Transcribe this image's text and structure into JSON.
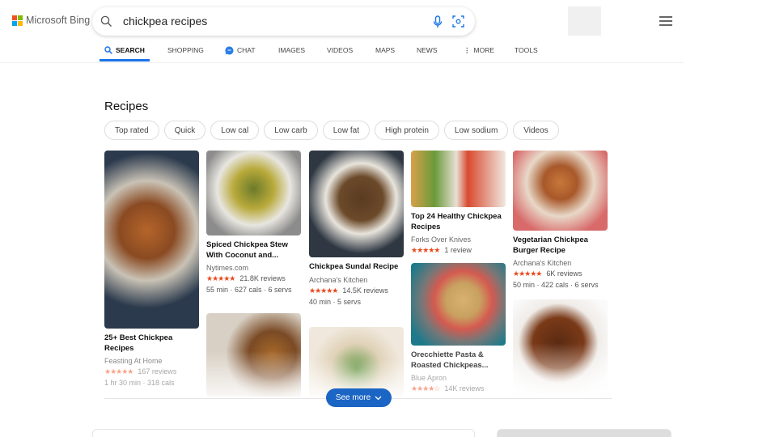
{
  "header": {
    "logo": "Microsoft Bing",
    "query": "chickpea recipes"
  },
  "nav": [
    {
      "label": "SEARCH",
      "icon": "search-icon",
      "active": true
    },
    {
      "label": "SHOPPING"
    },
    {
      "label": "CHAT",
      "icon": "chat-icon"
    },
    {
      "label": "IMAGES"
    },
    {
      "label": "VIDEOS"
    },
    {
      "label": "MAPS"
    },
    {
      "label": "NEWS"
    },
    {
      "label": "MORE",
      "icon": "more-vertical-icon"
    },
    {
      "label": "TOOLS"
    }
  ],
  "recipes": {
    "title": "Recipes",
    "chips": [
      "Top rated",
      "Quick",
      "Low cal",
      "Low carb",
      "Low fat",
      "High protein",
      "Low sodium",
      "Videos"
    ],
    "cards": [
      {
        "title": "25+ Best Chickpea Recipes",
        "source": "Feasting At Home",
        "stars": "★★★★★",
        "rating": 5,
        "reviews": "167 reviews",
        "meta": "1 hr 30 min · 318 cals"
      },
      {
        "title": "Spiced Chickpea Stew With Coconut and...",
        "source": "Nytimes.com",
        "stars": "★★★★★",
        "rating": 5,
        "reviews": "21.8K reviews",
        "meta": "55 min · 627 cals · 6 servs"
      },
      {
        "title": "Chickpea Sundal Recipe",
        "source": "Archana's Kitchen",
        "stars": "★★★★★",
        "rating": 5,
        "reviews": "14.5K reviews",
        "meta": "40 min · 5 servs"
      },
      {
        "title": "Top 24 Healthy Chickpea Recipes",
        "source": "Forks Over Knives",
        "stars": "★★★★★",
        "rating": 5,
        "reviews": "1 review"
      },
      {
        "title": "Orecchiette Pasta & Roasted Chickpeas...",
        "source": "Blue Apron",
        "stars": "★★★★☆",
        "rating": 3.5,
        "reviews": "14K reviews"
      },
      {
        "title": "Vegetarian Chickpea Burger Recipe",
        "source": "Archana's Kitchen",
        "stars": "★★★★★",
        "rating": 5,
        "reviews": "6K reviews",
        "meta": "50 min · 422 cals · 6 servs"
      }
    ],
    "see_more": "See more"
  },
  "colors": {
    "accent": "#1a73e8",
    "button": "#1b65c4",
    "stars": "#e8491d"
  }
}
